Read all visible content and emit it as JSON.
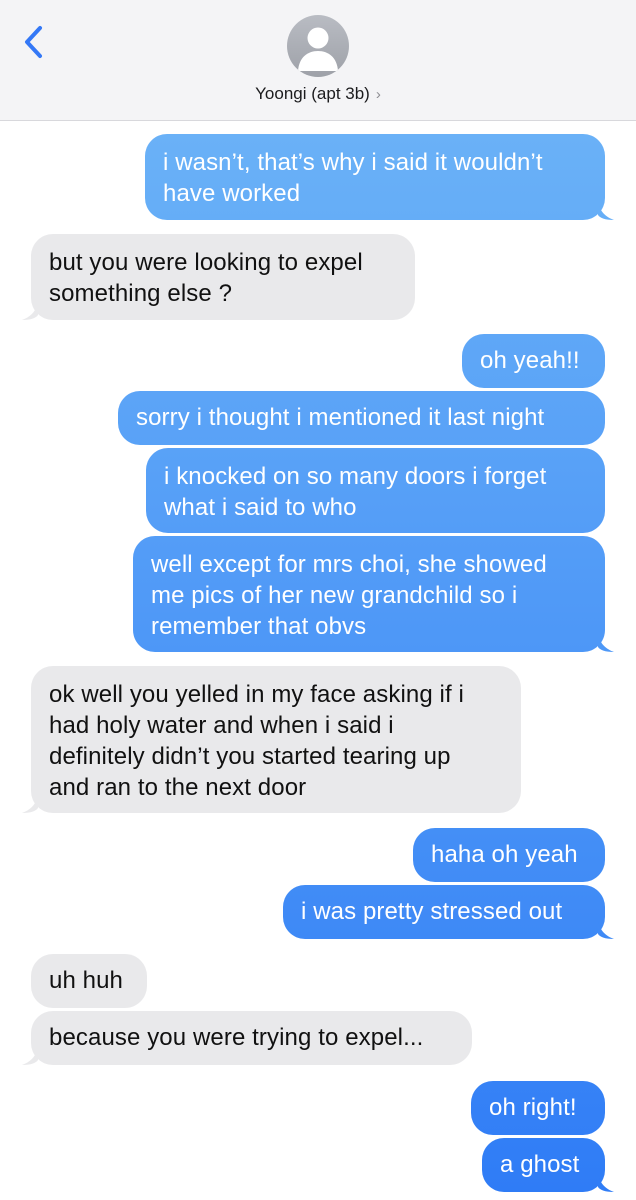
{
  "header": {
    "contact_name": "Yoongi (apt 3b)",
    "chevron": "›",
    "back_icon": "chevron-left-icon",
    "avatar_icon": "person-silhouette-icon"
  },
  "colors": {
    "sent_top": "#6bb2f7",
    "sent_bottom": "#2f7cf6",
    "received": "#e9e9eb",
    "accent": "#3478f6"
  },
  "messages": [
    {
      "from": "me",
      "text": "i wasn’t, that’s why i said it wouldn’t\nhave worked"
    },
    {
      "from": "them",
      "text": "but you were looking to expel\nsomething else ?"
    },
    {
      "from": "me",
      "text": "oh yeah!!"
    },
    {
      "from": "me",
      "text": "sorry i thought i mentioned it last night"
    },
    {
      "from": "me",
      "text": "i knocked on so many doors i forget\nwhat i said to who"
    },
    {
      "from": "me",
      "text": "well except for mrs choi, she showed\nme pics of her new grandchild so i\nremember that obvs"
    },
    {
      "from": "them",
      "text": "ok well you yelled in my face asking if i\nhad holy water and when i said i\ndefinitely didn’t you started tearing up\nand ran to the next door"
    },
    {
      "from": "me",
      "text": "haha oh yeah"
    },
    {
      "from": "me",
      "text": "i was pretty stressed out"
    },
    {
      "from": "them",
      "text": "uh huh"
    },
    {
      "from": "them",
      "text": "because you were trying to expel..."
    },
    {
      "from": "me",
      "text": "oh right!"
    },
    {
      "from": "me",
      "text": "a ghost"
    }
  ]
}
